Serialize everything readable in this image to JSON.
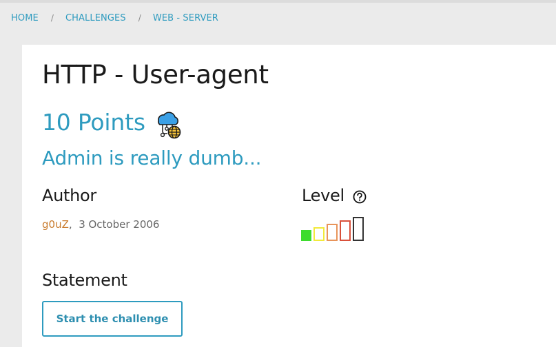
{
  "breadcrumb": {
    "items": [
      "HOME",
      "CHALLENGES",
      "WEB - SERVER"
    ],
    "separator": "/"
  },
  "challenge": {
    "title": "HTTP - User-agent",
    "points": "10 Points",
    "category_icon": "cloud-network-globe-icon",
    "subtitle": "Admin is really dumb..."
  },
  "author": {
    "heading": "Author",
    "name": "g0uZ",
    "separator": ",",
    "date": "3 October 2006"
  },
  "level": {
    "heading": "Level",
    "help_icon": "question-circle-icon",
    "current": 1,
    "max": 5,
    "colors": [
      "#3ddc2e",
      "#f2ea3a",
      "#e8945a",
      "#d9503a",
      "#333333"
    ]
  },
  "statement": {
    "heading": "Statement",
    "start_button": "Start the challenge"
  },
  "colors": {
    "accent": "#2e9bbf",
    "author_link": "#c8792a",
    "background": "#ebebeb",
    "card": "#ffffff"
  }
}
